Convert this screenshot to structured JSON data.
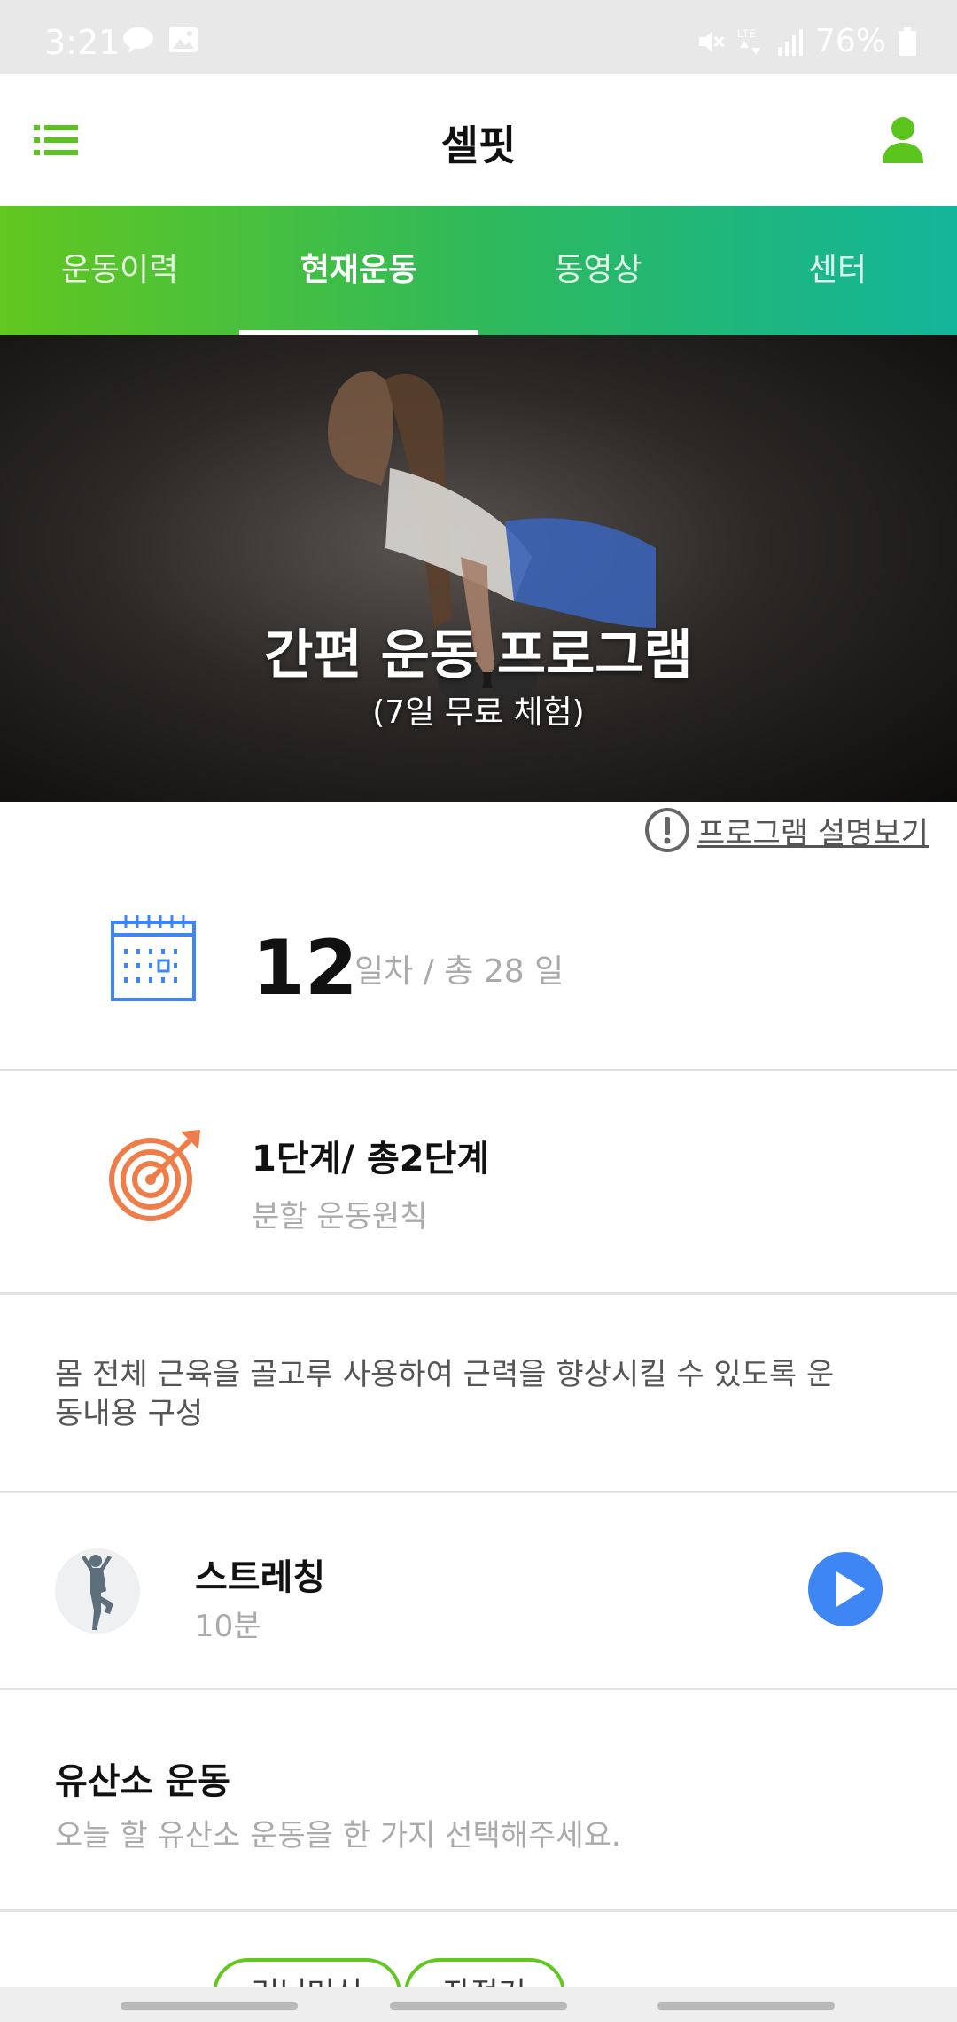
{
  "status_bar": {
    "time": "3:21",
    "battery": "76%",
    "icons": [
      "talk-icon",
      "image-icon",
      "mute-icon",
      "lte-icon",
      "signal-icon",
      "battery-icon"
    ]
  },
  "app_bar": {
    "title": "셀핏",
    "menu_icon": "menu-icon",
    "profile_icon": "profile-icon",
    "accent_color": "#5cc51d"
  },
  "tabs": [
    {
      "label": "운동이력",
      "active": false
    },
    {
      "label": "현재운동",
      "active": true
    },
    {
      "label": "동영상",
      "active": false
    },
    {
      "label": "센터",
      "active": false
    }
  ],
  "hero": {
    "title": "간편 운동 프로그램",
    "subtitle": "(7일 무료 체험)"
  },
  "program_info_link": "프로그램 설명보기",
  "day": {
    "current": "12",
    "rest": "일차 / 총 28 일"
  },
  "stage": {
    "title": "1단계/ 총2단계",
    "subtitle": "분할 운동원칙"
  },
  "description": "몸 전체 근육을 골고루 사용하여 근력을 향상시킬 수 있도록 운동내용 구성",
  "stretching": {
    "title": "스트레칭",
    "duration": "10분",
    "play_color": "#3d86f3"
  },
  "cardio": {
    "title": "유산소 운동",
    "subtitle": "오늘 할 유산소 운동을 한 가지 선택해주세요."
  },
  "cardio_options": [
    "러닝머신",
    "자전거"
  ]
}
